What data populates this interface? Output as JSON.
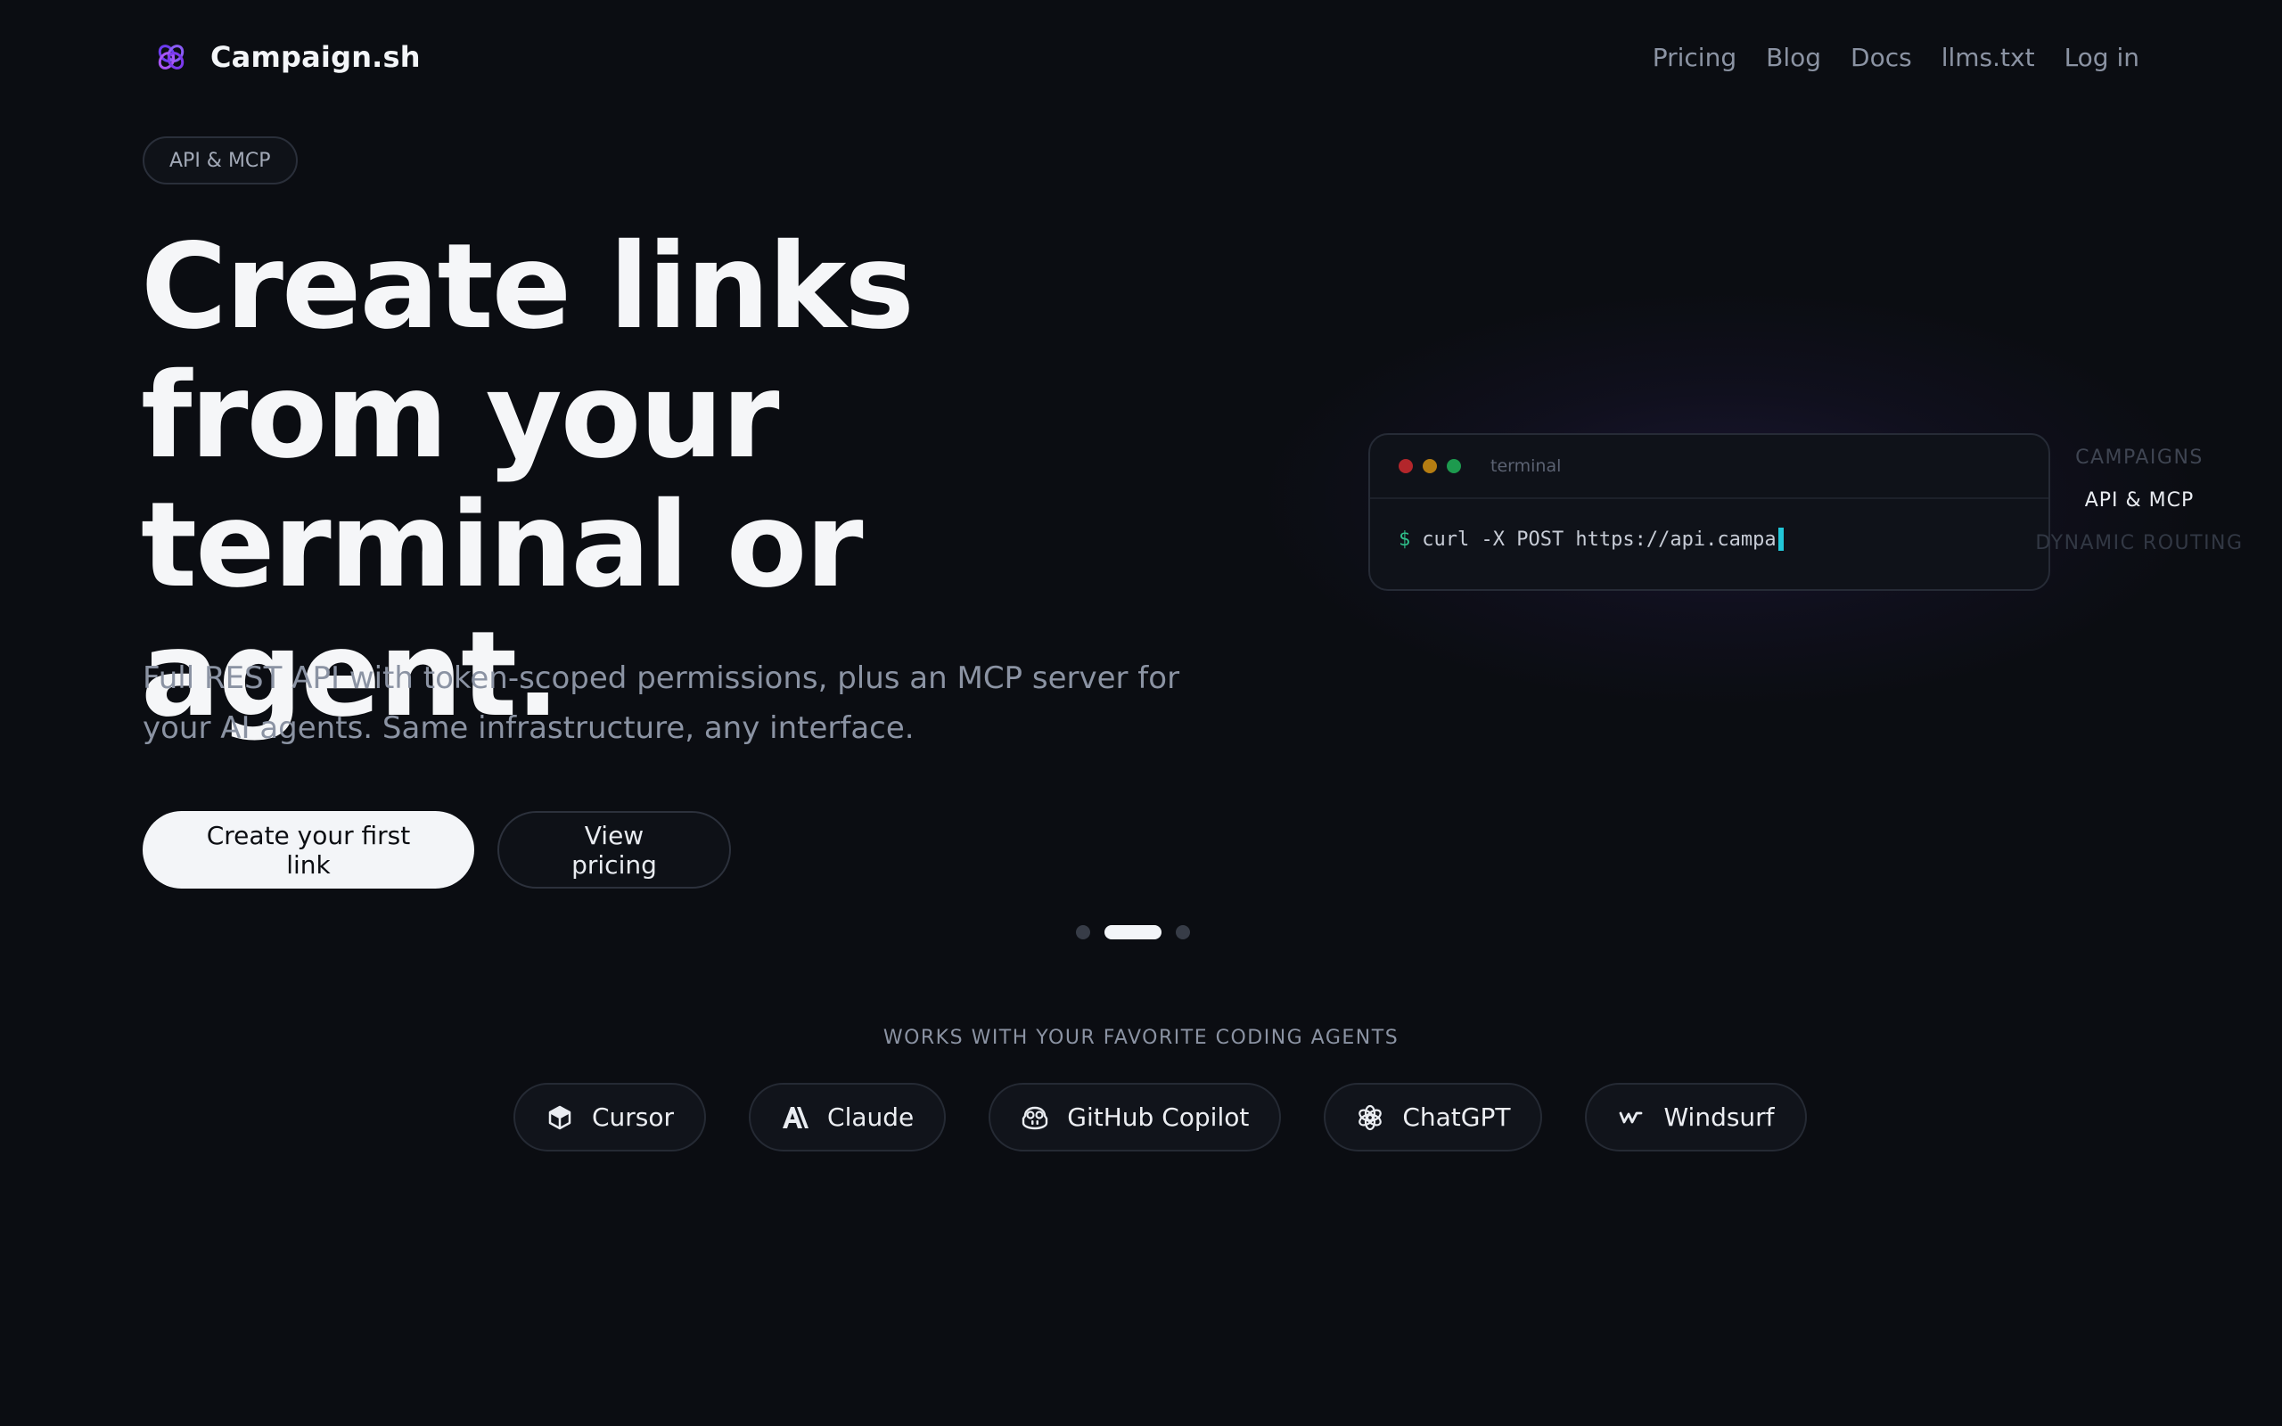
{
  "brand": {
    "name": "Campaign.sh",
    "logo_icon": "interlinked-rings-icon",
    "accent_colors": [
      "#6d3cf0",
      "#a855f7"
    ]
  },
  "nav": {
    "links": [
      {
        "label": "Pricing"
      },
      {
        "label": "Blog"
      },
      {
        "label": "Docs"
      },
      {
        "label": "llms.txt"
      },
      {
        "label": "Log in"
      }
    ]
  },
  "hero": {
    "badge": "API & MCP",
    "headline": "Create links from your terminal or agent.",
    "subtitle": "Full REST API with token-scoped permissions, plus an MCP server for your AI agents. Same infrastructure, any interface.",
    "primary_cta": "Create your first link",
    "secondary_cta": "View pricing"
  },
  "terminal": {
    "title": "terminal",
    "prompt": "$",
    "command": "curl -X POST https://api.campa"
  },
  "feature_tabs": [
    {
      "label": "CAMPAIGNS",
      "state": "dim"
    },
    {
      "label": "API & MCP",
      "state": "active"
    },
    {
      "label": "DYNAMIC ROUTING",
      "state": "faint"
    }
  ],
  "carousel": {
    "total": 3,
    "active_index": 1
  },
  "agents": {
    "heading": "WORKS WITH YOUR FAVORITE CODING AGENTS",
    "items": [
      {
        "label": "Cursor",
        "icon": "cube-icon"
      },
      {
        "label": "Claude",
        "icon": "anthropic-icon"
      },
      {
        "label": "GitHub Copilot",
        "icon": "copilot-icon"
      },
      {
        "label": "ChatGPT",
        "icon": "openai-icon"
      },
      {
        "label": "Windsurf",
        "icon": "windsurf-icon"
      }
    ]
  }
}
